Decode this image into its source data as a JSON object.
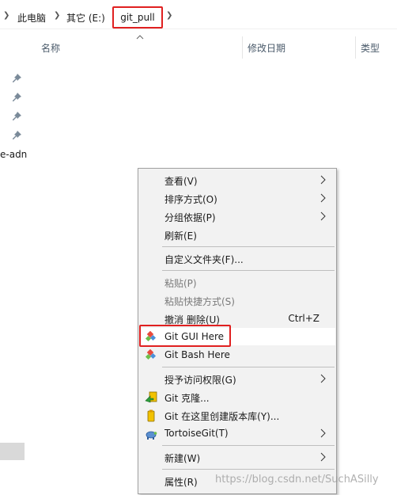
{
  "address_bar": {
    "crumbs": [
      "此电脑",
      "其它 (E:)",
      "git_pull"
    ]
  },
  "columns": {
    "name": "名称",
    "modified": "修改日期",
    "type": "类型"
  },
  "nav": {
    "partial_item": "e-adn"
  },
  "context_menu": {
    "view": "查看(V)",
    "sort": "排序方式(O)",
    "group": "分组依据(P)",
    "refresh": "刷新(E)",
    "customize": "自定义文件夹(F)...",
    "paste": "粘贴(P)",
    "paste_shortcut": "粘贴快捷方式(S)",
    "undo_delete": "撤消 删除(U)",
    "undo_shortcut": "Ctrl+Z",
    "git_gui": "Git GUI Here",
    "git_bash": "Git Bash Here",
    "grant_access": "授予访问权限(G)",
    "git_clone": "Git 克隆...",
    "git_init": "Git 在这里创建版本库(Y)...",
    "tortoisegit": "TortoiseGit(T)",
    "new": "新建(W)",
    "properties": "属性(R)"
  },
  "watermark": "https://blog.csdn.net/SuchASilly",
  "colors": {
    "highlight_box": "#e02020",
    "menu_bg": "#f2f2f2"
  }
}
